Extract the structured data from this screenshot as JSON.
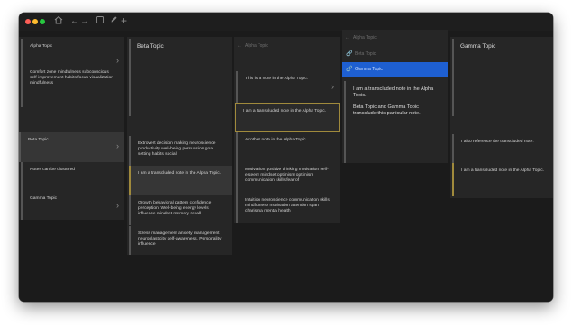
{
  "toolbar": {
    "home_icon": "home-icon",
    "back_icon": "arrow-left-icon",
    "forward_icon": "arrow-right-icon",
    "panel_icon": "square-icon",
    "pencil_icon": "pencil-icon",
    "plus_icon": "plus-icon"
  },
  "colors": {
    "window_bg": "#1b1b1b",
    "panel_bg": "#262626",
    "selected_menu": "#1e5fd1",
    "transclusion_border": "#a08a3c",
    "traffic_red": "#fe5f57",
    "traffic_yellow": "#febc2e",
    "traffic_green": "#28c840"
  },
  "col1": {
    "alpha": "Alpha Topic",
    "alpha_note": "Comfort zone mindfulness subconscious self-improvement habits focus visualization mindfulness",
    "beta": "Beta Topic",
    "clustered": "Notes can be clustered",
    "gamma": "Gamma Topic"
  },
  "col2": {
    "title": "Beta Topic",
    "note1": "Extrovert decision making neuroscience productivity well-being persuasion goal setting habits social",
    "note2": "I am a transcluded note in the Alpha Topic.",
    "note3": "Growth behavioral pattern confidence perception. Well-being energy levels influence mindset memory recall",
    "note4": "Stress management anxiety management neuroplasticity self-awareness. Personality influence"
  },
  "col3": {
    "header": "Alpha Topic",
    "note1": "This is a note in the Alpha Topic.",
    "note2": "I am a transcluded note in the Alpha Topic.",
    "note3": "Another note in the Alpha Topic.",
    "note4": "Motivation positive thinking motivation self-esteem mindset optimism optimism communication skills fear of",
    "note5": "Intuition neuroscience communication skills mindfulness motivation attention span charisma mental health"
  },
  "col4": {
    "header": "Alpha Topic",
    "menu1": "Beta Topic",
    "menu2": "Gamma Topic",
    "note1": "I am a transcluded note in the Alpha Topic.",
    "note2": "Beta Topic and Gamma Topic transclude this particular note."
  },
  "col5": {
    "title": "Gamma Topic",
    "note1": "I also reference the transcluded note.",
    "note2": "I am a transcluded note in the Alpha Topic."
  }
}
